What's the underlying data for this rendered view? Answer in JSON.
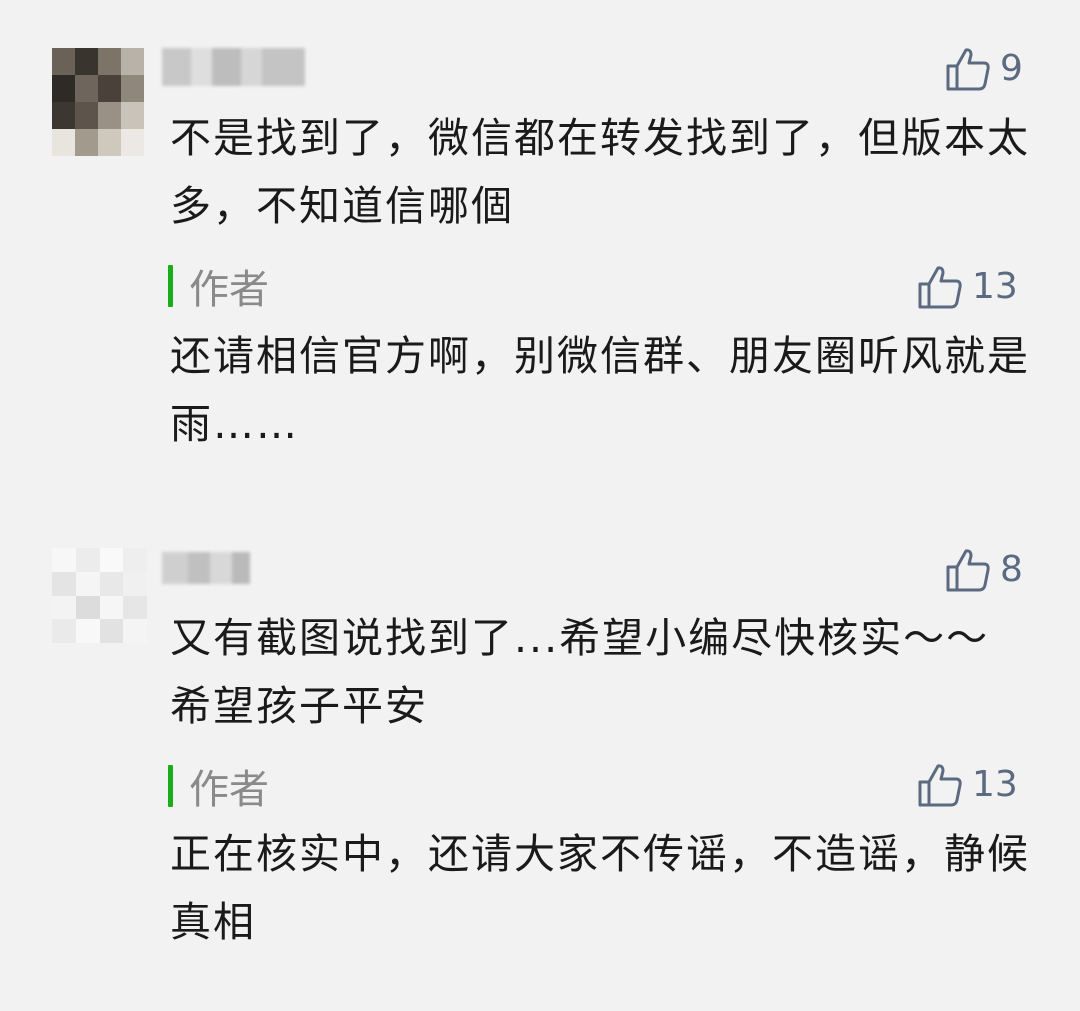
{
  "comments": [
    {
      "likes": "9",
      "text": "不是找到了，微信都在转发找到了，但版本太多，不知道信哪個",
      "reply": {
        "author_label": "作者",
        "likes": "13",
        "text": "还请相信官方啊，别微信群、朋友圈听风就是雨……"
      }
    },
    {
      "likes": "8",
      "text": "又有截图说找到了...希望小编尽快核实～～希望孩子平安",
      "reply": {
        "author_label": "作者",
        "likes": "13",
        "text": "正在核实中，还请大家不传谣，不造谣，静候真相"
      }
    }
  ],
  "icons": {
    "like": "thumbs-up-outline-icon"
  },
  "colors": {
    "background": "#f2f2f2",
    "author_bar": "#1aad19",
    "like": "#5b6a80",
    "text": "#1a1a1a",
    "author_label": "#8a8a8a"
  }
}
